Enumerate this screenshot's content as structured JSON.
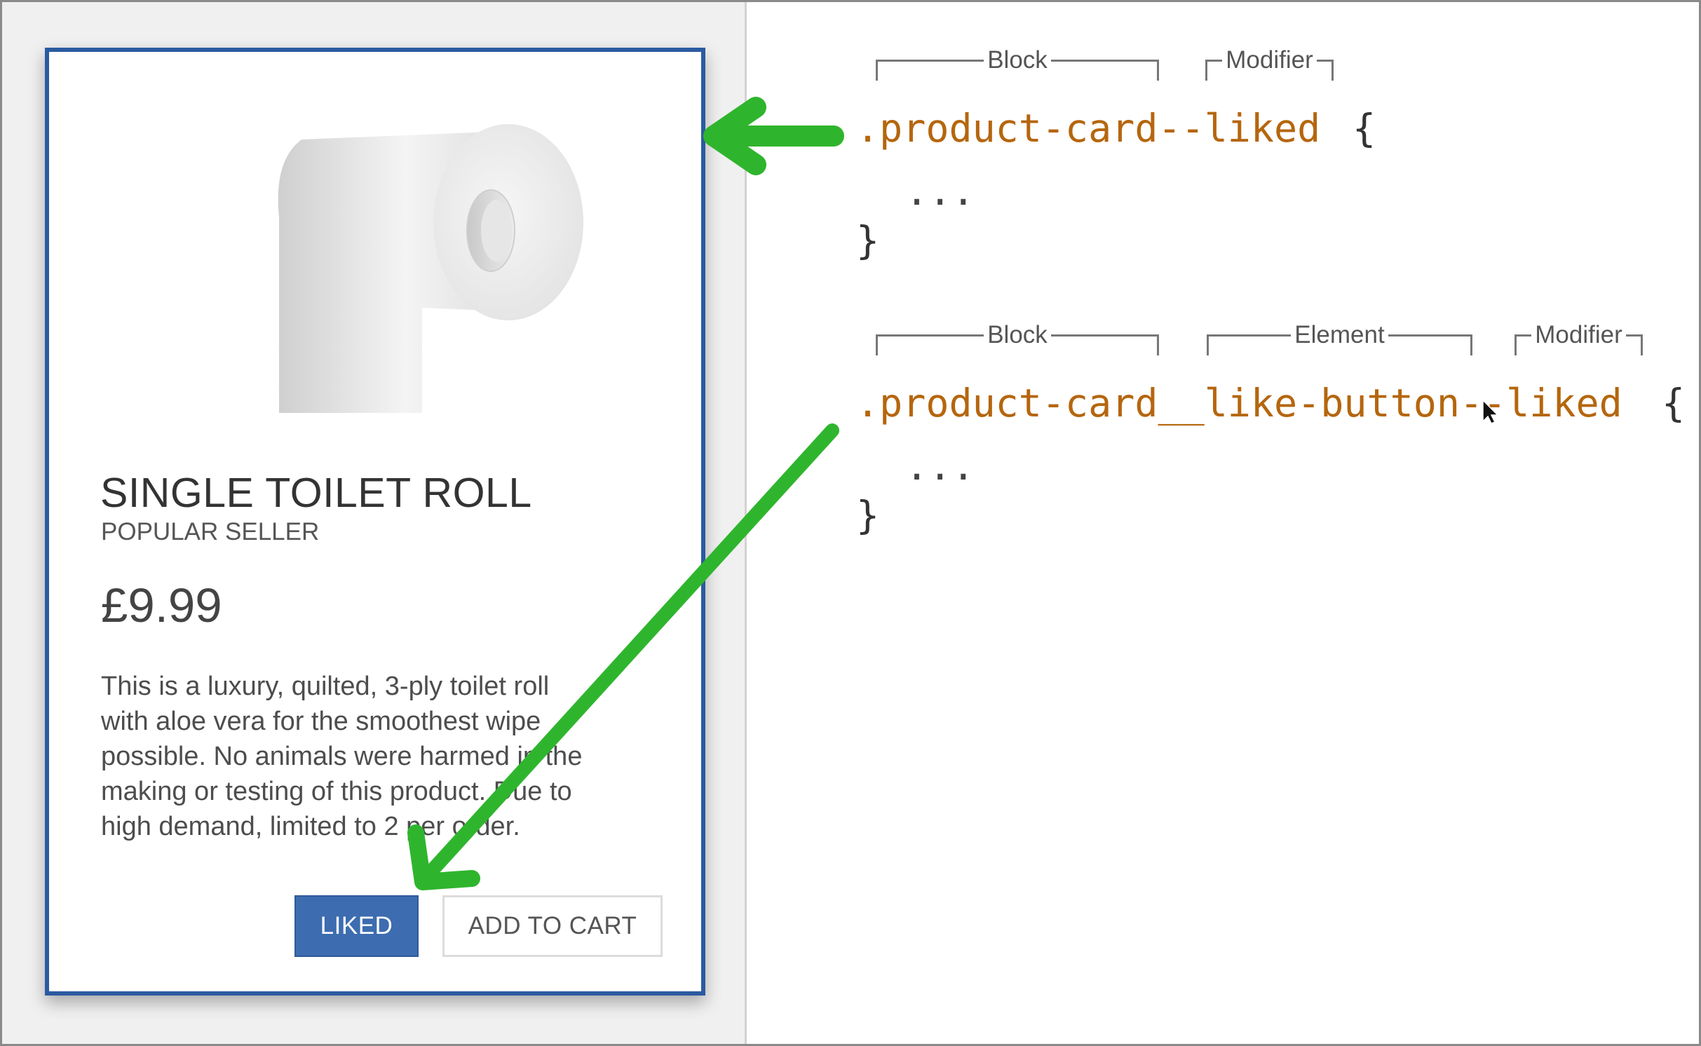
{
  "product_card": {
    "title": "SINGLE TOILET ROLL",
    "subtitle": "POPULAR SELLER",
    "price": "£9.99",
    "description_lines": [
      "This is a luxury, quilted, 3-ply toilet roll",
      "with aloe vera for the smoothest wipe",
      "possible. No animals were harmed in the",
      "making or testing of this product. Due to",
      "high demand, limited to 2 per order."
    ],
    "like_button_label": "LIKED",
    "cart_button_label": "ADD TO CART",
    "image_icon": "toilet-roll-icon"
  },
  "code_examples": [
    {
      "selector": ".product-card--liked",
      "open_brace": "{",
      "body": "...",
      "close_brace": "}",
      "brackets": [
        "Block",
        "Modifier"
      ]
    },
    {
      "selector": ".product-card__like-button--liked",
      "open_brace": "{",
      "body": "...",
      "close_brace": "}",
      "brackets": [
        "Block",
        "Element",
        "Modifier"
      ]
    }
  ],
  "colors": {
    "card_border": "#2b5aa0",
    "like_button": "#3d6cb0",
    "selector_text": "#b5660e",
    "arrow": "#2fb52d",
    "left_background": "#f0f0f0"
  }
}
